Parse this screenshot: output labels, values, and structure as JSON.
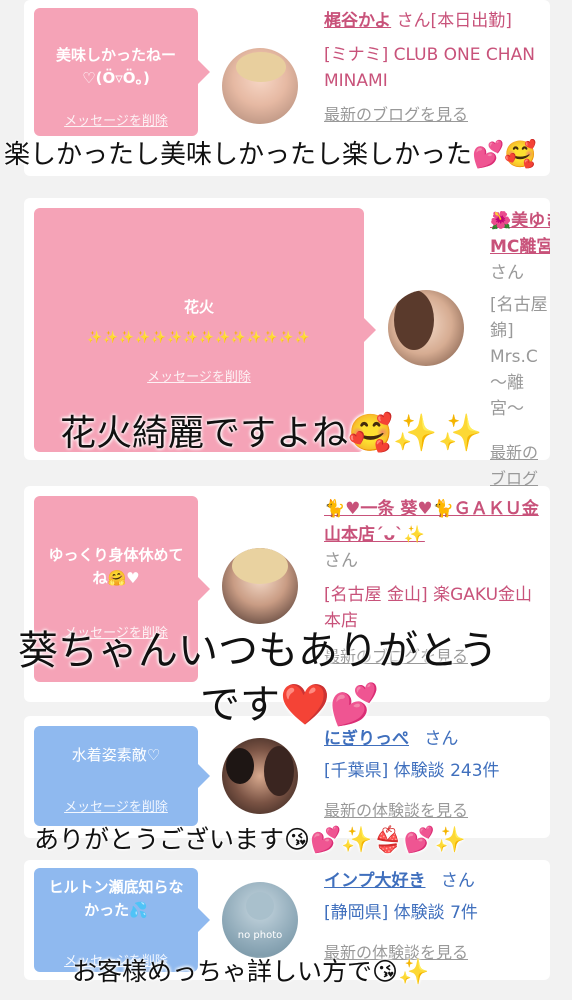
{
  "cards": [
    {
      "message": "美味しかったねー♡(Ö▿Ö。)",
      "delete_label": "メッセージを削除",
      "name": "梶谷かよ",
      "honorific": "さん[本日出勤]",
      "shop": "[ミナミ] CLUB ONE CHAN MINAMI",
      "link": "最新のブログを見る"
    },
    {
      "message_line1": "花火",
      "message_line2": "✨✨✨✨✨✨✨✨✨✨✨✨✨✨",
      "delete_label": "メッセージを削除",
      "name": "🌺美ゆき",
      "name2": "MC離宮🌺",
      "honorific": "さん",
      "shop": "[名古屋 錦] Mrs.C 〜離宮〜",
      "link": "最新のブログを見る"
    },
    {
      "message": "ゆっくり身体休めてね🤗♥",
      "delete_label": "メッセージを削除",
      "name": "🐈♥一条 葵♥🐈ＧＡＫＵ金山本店´ᴗ`✨",
      "honorific": "さん",
      "shop": "[名古屋 金山] 楽GAKU金山本店",
      "link": "最新のブログを見る"
    },
    {
      "message": "水着姿素敵♡",
      "delete_label": "メッセージを削除",
      "name": "にぎりっぺ",
      "honorific": "さん",
      "shop": "[千葉県] 体験談 243件",
      "link": "最新の体験談を見る"
    },
    {
      "message": "ヒルトン瀬底知らなかった💦",
      "delete_label": "メッセージを削除",
      "name": "インプ大好き",
      "honorific": "さん",
      "shop": "[静岡県] 体験談 7件",
      "link": "最新の体験談を見る",
      "no_photo": "no photo"
    }
  ],
  "overlays": {
    "t1": "楽しかったし美味しかったし楽しかった💕🥰",
    "t2": "花火綺麗ですよね🥰✨✨",
    "t3a": "葵ちゃんいつもありがとう",
    "t3b": "です❤️💕",
    "t4": "ありがとうございます😘💕✨👙💕✨",
    "t5": "お客様めっちゃ詳しい方で😘✨"
  },
  "colors": {
    "pink_bubble": "#f5a3b7",
    "blue_bubble": "#8fb9ef",
    "pink_text": "#c8527a",
    "blue_text": "#3f6fbd"
  }
}
